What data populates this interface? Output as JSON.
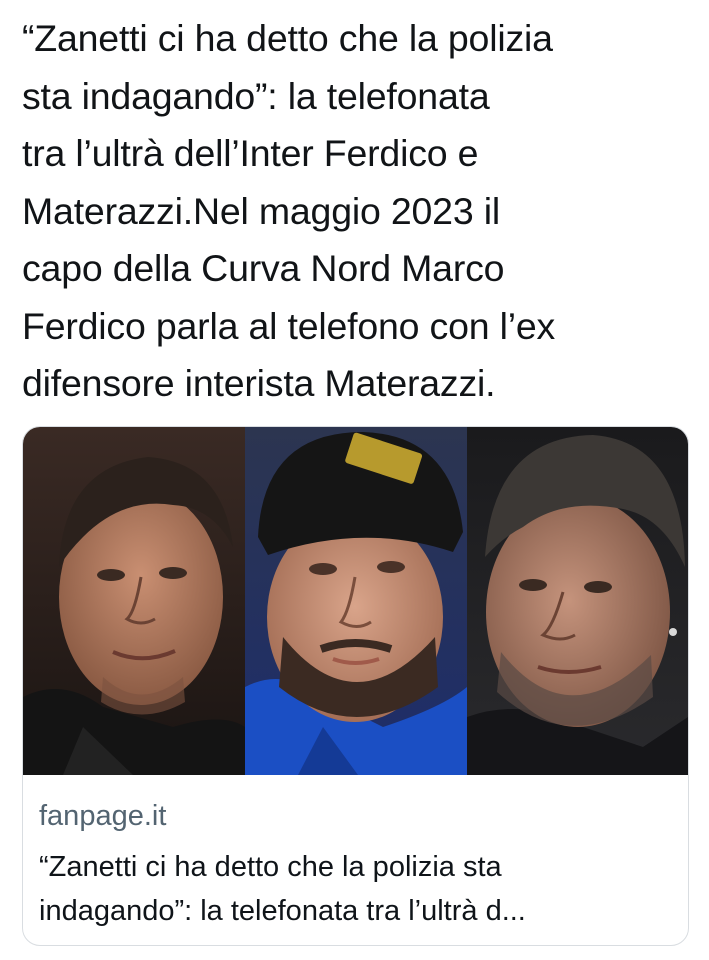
{
  "tweet": {
    "text": "“Zanetti ci ha detto che la polizia\nsta indagando”: la telefonata\ntra l’ultrà dell’Inter Ferdico e\nMaterazzi.Nel maggio 2023 il\ncapo della Curva Nord Marco\nFerdico parla al telefono con l’ex\ndifensore interista Materazzi."
  },
  "card": {
    "domain": "fanpage.it",
    "title": "“Zanetti ci ha detto che la polizia sta\nindagando”: la telefonata tra l’ultrà d..."
  },
  "colors": {
    "text": "#0f1419",
    "secondary_text": "#536471",
    "card_border": "#d9dde1",
    "blue_jacket": "#1b4fc4"
  }
}
